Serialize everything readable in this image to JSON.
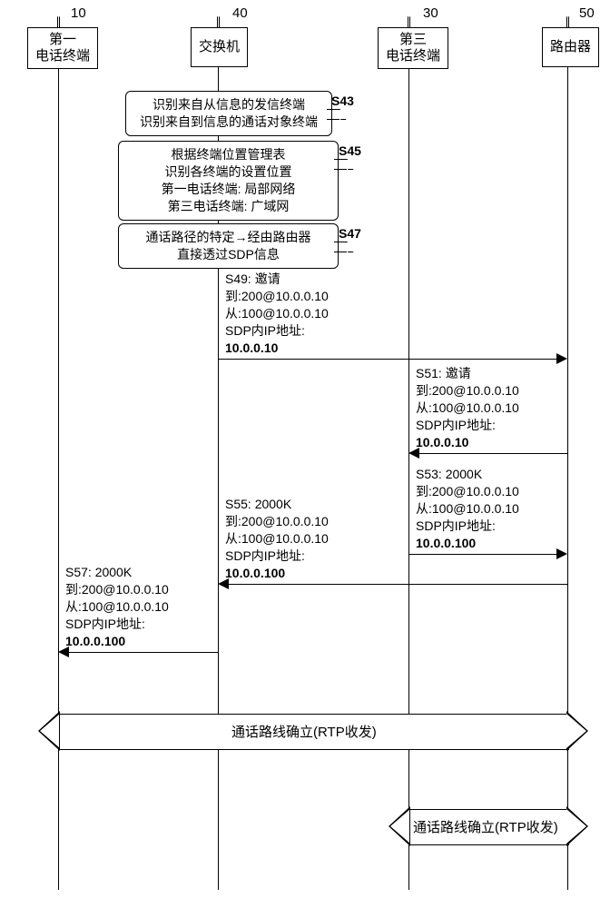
{
  "actors": {
    "a1": {
      "num": "10",
      "label": "第一\n电话终端"
    },
    "a2": {
      "num": "40",
      "label": "交换机"
    },
    "a3": {
      "num": "30",
      "label": "第三\n电话终端"
    },
    "a4": {
      "num": "50",
      "label": "路由器"
    }
  },
  "processes": {
    "p43": {
      "step": "S43",
      "text": "识别来自从信息的发信终端\n识别来自到信息的通话对象终端"
    },
    "p45": {
      "step": "S45",
      "text": "根据终端位置管理表\n识别各终端的设置位置\n第一电话终端: 局部网络\n第三电话终端: 广域网"
    },
    "p47": {
      "step": "S47",
      "text": "通话路径的特定→经由路由器\n直接透过SDP信息"
    }
  },
  "messages": {
    "m49": {
      "step": "S49: 邀请",
      "to": "到:200@10.0.0.10",
      "from": "从:100@10.0.0.10",
      "sdp": "SDP内IP地址:",
      "ip": "10.0.0.10"
    },
    "m51": {
      "step": "S51: 邀请",
      "to": "到:200@10.0.0.10",
      "from": "从:100@10.0.0.10",
      "sdp": "SDP内IP地址:",
      "ip": "10.0.0.10"
    },
    "m53": {
      "step": "S53: 2000K",
      "to": "到:200@10.0.0.10",
      "from": "从:100@10.0.0.10",
      "sdp": "SDP内IP地址:",
      "ip": "10.0.0.100"
    },
    "m55": {
      "step": "S55: 2000K",
      "to": "到:200@10.0.0.10",
      "from": "从:100@10.0.0.10",
      "sdp": "SDP内IP地址:",
      "ip": "10.0.0.100"
    },
    "m57": {
      "step": "S57: 2000K",
      "to": "到:200@10.0.0.10",
      "from": "从:100@10.0.0.10",
      "sdp": "SDP内IP地址:",
      "ip": "10.0.0.100"
    }
  },
  "rtp": {
    "label1": "通话路线确立(RTP收发)",
    "label2": "通话路线确立(RTP收发)"
  }
}
